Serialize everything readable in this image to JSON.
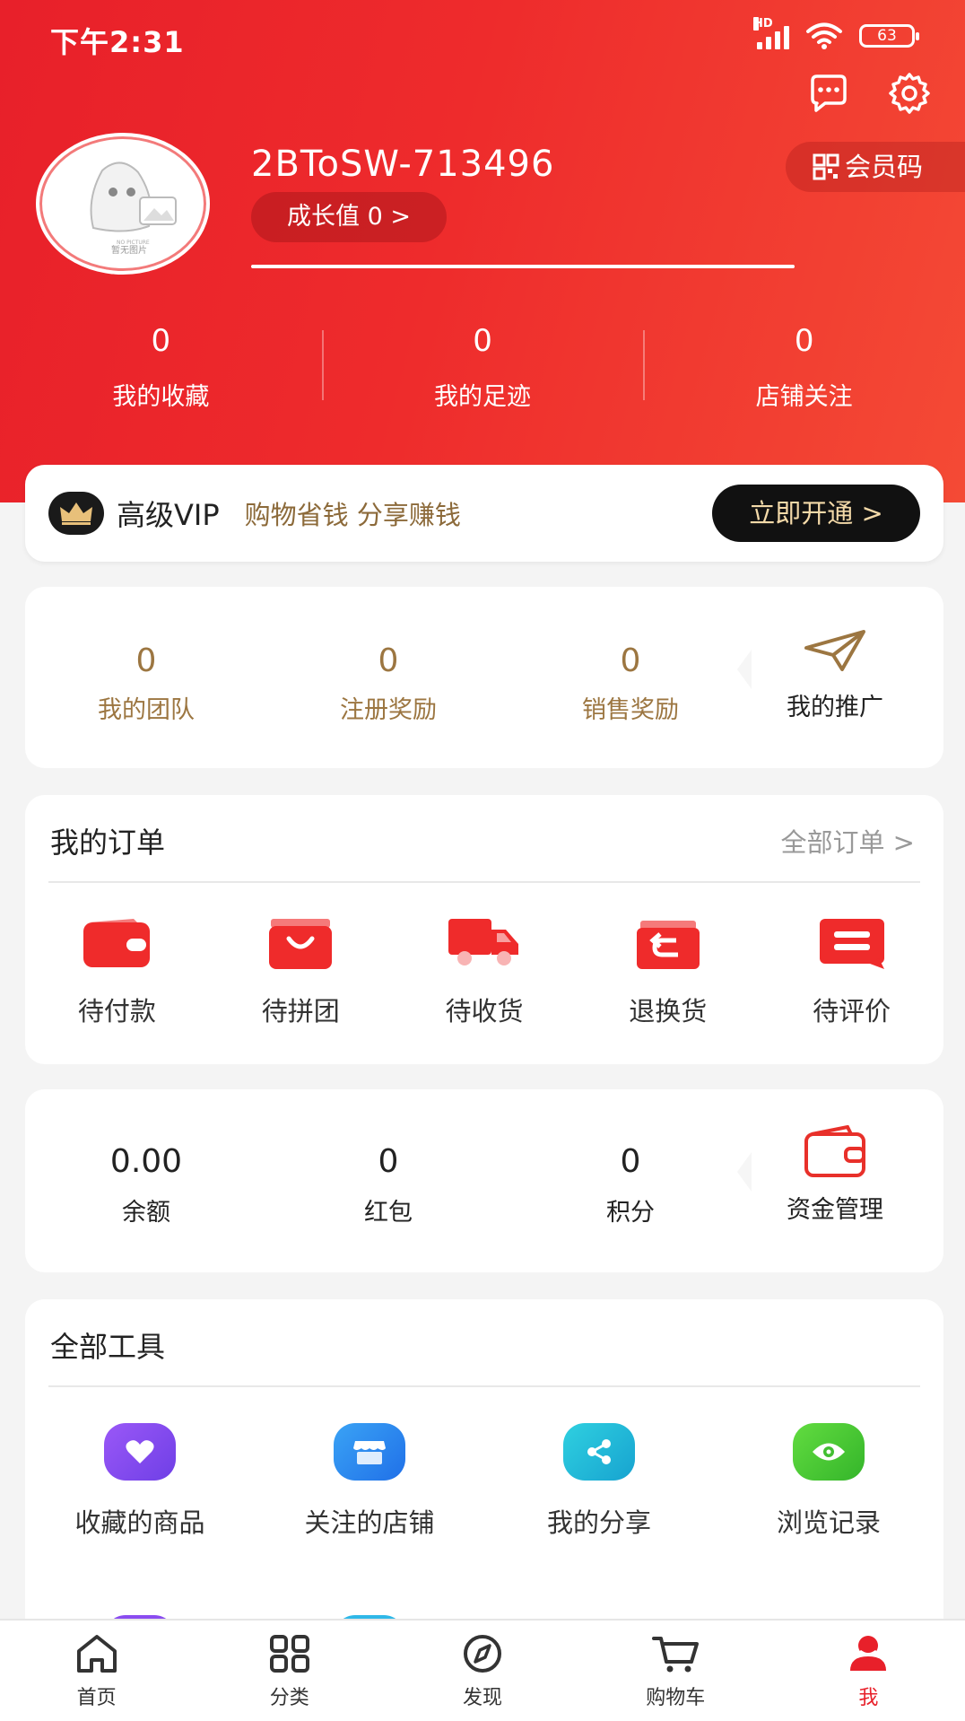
{
  "status_bar": {
    "time": "下午2:31",
    "network": "HD",
    "battery": "63"
  },
  "header": {
    "username": "2BToSW-713496",
    "growth_label": "成长值 0 >",
    "member_code": "会员码",
    "avatar_caption_top": "NO PICTURE",
    "avatar_caption": "暂无图片",
    "stats": [
      {
        "value": "0",
        "label": "我的收藏"
      },
      {
        "value": "0",
        "label": "我的足迹"
      },
      {
        "value": "0",
        "label": "店铺关注"
      }
    ]
  },
  "vip": {
    "title": "高级VIP",
    "subtitle": "购物省钱 分享赚钱",
    "button": "立即开通 >"
  },
  "promotion": {
    "items": [
      {
        "value": "0",
        "label": "我的团队"
      },
      {
        "value": "0",
        "label": "注册奖励"
      },
      {
        "value": "0",
        "label": "销售奖励"
      }
    ],
    "side_label": "我的推广"
  },
  "orders": {
    "title": "我的订单",
    "all_link": "全部订单 >",
    "items": [
      {
        "label": "待付款",
        "icon": "wallet-icon"
      },
      {
        "label": "待拼团",
        "icon": "shopping-bag-icon"
      },
      {
        "label": "待收货",
        "icon": "truck-icon"
      },
      {
        "label": "退换货",
        "icon": "return-icon"
      },
      {
        "label": "待评价",
        "icon": "comment-icon"
      }
    ]
  },
  "wallet": {
    "items": [
      {
        "value": "0.00",
        "label": "余额"
      },
      {
        "value": "0",
        "label": "红包"
      },
      {
        "value": "0",
        "label": "积分"
      }
    ],
    "side_label": "资金管理"
  },
  "tools": {
    "title": "全部工具",
    "items": [
      {
        "label": "收藏的商品",
        "icon": "heart-icon",
        "color": "#8a4cf0"
      },
      {
        "label": "关注的店铺",
        "icon": "store-icon",
        "color": "#2f8ff0"
      },
      {
        "label": "我的分享",
        "icon": "share-icon",
        "color": "#1fb8d8"
      },
      {
        "label": "浏览记录",
        "icon": "eye-icon",
        "color": "#4cc93a"
      }
    ]
  },
  "tabbar": {
    "items": [
      {
        "label": "首页",
        "icon": "home-icon"
      },
      {
        "label": "分类",
        "icon": "category-icon"
      },
      {
        "label": "发现",
        "icon": "compass-icon"
      },
      {
        "label": "购物车",
        "icon": "cart-icon"
      },
      {
        "label": "我",
        "icon": "profile-icon"
      }
    ],
    "active_color": "#e8202a"
  },
  "colors": {
    "brand_red": "#e8202a",
    "gold_text": "#9c7641"
  }
}
